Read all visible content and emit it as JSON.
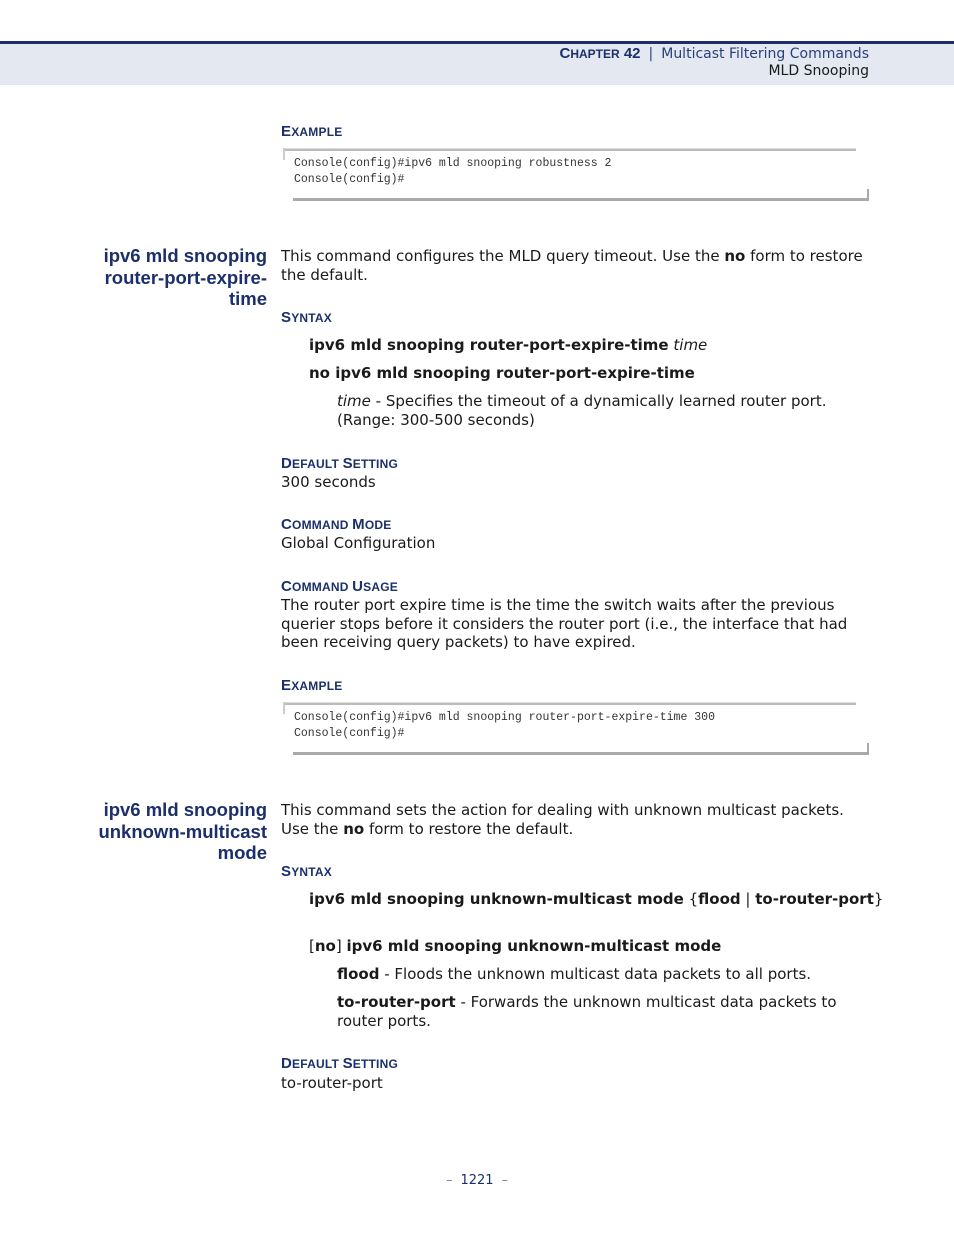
{
  "header": {
    "chapter_prefix": "C",
    "chapter_rest": "HAPTER",
    "chapter_number": "42",
    "separator": "|",
    "chapter_title": "Multicast Filtering Commands",
    "section": "MLD Snooping"
  },
  "example1": {
    "heading_first": "E",
    "heading_rest": "XAMPLE",
    "code": "Console(config)#ipv6 mld snooping robustness 2\nConsole(config)#"
  },
  "cmd1": {
    "title_lines": [
      "ipv6 mld snooping",
      "router-port-expire-",
      "time"
    ],
    "intro_pre": "This command configures the MLD query timeout. Use the ",
    "intro_bold": "no",
    "intro_post": " form to restore the default.",
    "syntax_heading_first": "S",
    "syntax_heading_rest": "YNTAX",
    "syntax1_bold": "ipv6 mld snooping router-port-expire-time",
    "syntax1_italic": "time",
    "syntax2_bold": "no ipv6 mld snooping router-port-expire-time",
    "param_name": "time",
    "param_desc": " - Specifies the timeout of a dynamically learned router port. (Range: 300-500 seconds)",
    "default_heading_first": [
      "D",
      "S"
    ],
    "default_heading_rest": [
      "EFAULT ",
      "ETTING"
    ],
    "default_value": "300 seconds",
    "mode_heading_first": [
      "C",
      "M"
    ],
    "mode_heading_rest": [
      "OMMAND ",
      "ODE"
    ],
    "mode_value": "Global Configuration",
    "usage_heading_first": [
      "C",
      "U"
    ],
    "usage_heading_rest": [
      "OMMAND ",
      "SAGE"
    ],
    "usage_text": "The router port expire time is the time the switch waits after the previous querier stops before it considers the router port (i.e., the interface that had been receiving query packets) to have expired.",
    "example_heading_first": "E",
    "example_heading_rest": "XAMPLE",
    "code": "Console(config)#ipv6 mld snooping router-port-expire-time 300\nConsole(config)#"
  },
  "cmd2": {
    "title_lines": [
      "ipv6 mld snooping",
      "unknown-multicast",
      "mode"
    ],
    "intro_pre": "This command sets the action for dealing with unknown multicast packets. Use the ",
    "intro_bold": "no",
    "intro_post": " form to restore the default.",
    "syntax_heading_first": "S",
    "syntax_heading_rest": "YNTAX",
    "syntax1_bold": "ipv6 mld snooping unknown-multicast mode",
    "syntax1_brace_open": "{",
    "syntax1_opt1": "flood",
    "syntax1_pipe": " |",
    "syntax1_opt2": "to-router-port",
    "syntax1_brace_close": "}",
    "syntax2_bracket_open": "[",
    "syntax2_no": "no",
    "syntax2_bracket_close": "]",
    "syntax2_bold": "ipv6 mld snooping unknown-multicast mode",
    "param1_name": "flood",
    "param1_desc": " - Floods the unknown multicast data packets to all ports.",
    "param2_name": "to-router-port",
    "param2_desc": " - Forwards the unknown multicast data packets to router ports.",
    "default_heading_first": [
      "D",
      "S"
    ],
    "default_heading_rest": [
      "EFAULT ",
      "ETTING"
    ],
    "default_value": "to-router-port"
  },
  "footer": {
    "dash": "–",
    "page_number": "1221"
  }
}
